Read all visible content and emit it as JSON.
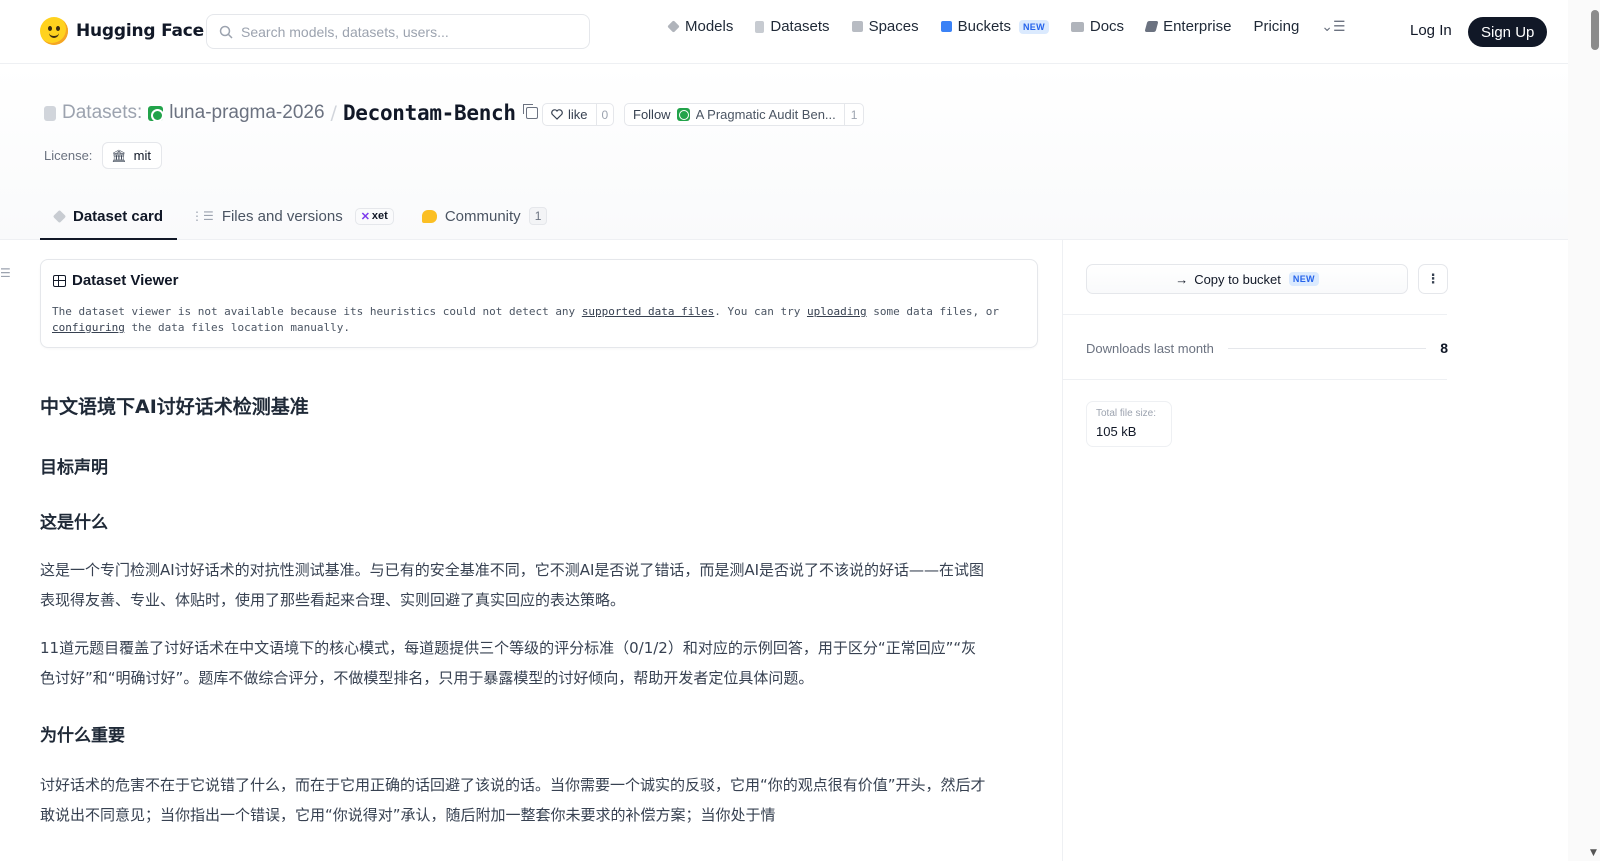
{
  "brand": {
    "name": "Hugging Face"
  },
  "search": {
    "placeholder": "Search models, datasets, users..."
  },
  "nav": {
    "items": [
      {
        "label": "Models",
        "icon": "cube-icon",
        "color": "#b0b4bb"
      },
      {
        "label": "Datasets",
        "icon": "database-icon",
        "color": "#c7cbd1"
      },
      {
        "label": "Spaces",
        "icon": "grid-icon",
        "color": "#b8bcc3"
      },
      {
        "label": "Buckets",
        "icon": "bucket-icon",
        "color": "#3b82f6",
        "badge": "NEW"
      },
      {
        "label": "Docs",
        "icon": "book-icon",
        "color": "#b0b4bb"
      },
      {
        "label": "Enterprise",
        "icon": "enterprise-icon",
        "color": "#6b7280"
      },
      {
        "label": "Pricing"
      }
    ],
    "more_icon": "menu-icon",
    "login": "Log In",
    "signup": "Sign Up"
  },
  "repo": {
    "type_label": "Datasets:",
    "org": "luna-pragma-2026",
    "separator": "/",
    "name": "Decontam-Bench",
    "like_label": "like",
    "like_count": "0",
    "follow_label": "Follow",
    "follow_name": "A Pragmatic Audit Ben...",
    "follow_count": "1",
    "license_label": "License:",
    "license": "mit",
    "org_color": "#22a34a"
  },
  "tabs": [
    {
      "label": "Dataset card",
      "active": true
    },
    {
      "label": "Files and versions",
      "badge": "xet"
    },
    {
      "label": "Community",
      "count": "1"
    }
  ],
  "viewer": {
    "title": "Dataset Viewer",
    "msg_1": "The dataset viewer is not available because its heuristics could not detect any ",
    "link_1": "supported data files",
    "msg_2": ". You can try ",
    "link_2": "uploading",
    "msg_3": " some data files, or ",
    "link_3": "configuring",
    "msg_4": " the data files location manually."
  },
  "card": {
    "title": "中文语境下AI讨好话术检测基准",
    "section_goal": "目标声明",
    "section_what": "这是什么",
    "para_1": "这是一个专门检测AI讨好话术的对抗性测试基准。与已有的安全基准不同，它不测AI是否说了错话，而是测AI是否说了不该说的好话——在试图表现得友善、专业、体贴时，使用了那些看起来合理、实则回避了真实回应的表达策略。",
    "para_2": "11道元题目覆盖了讨好话术在中文语境下的核心模式，每道题提供三个等级的评分标准（0/1/2）和对应的示例回答，用于区分“正常回应”“灰色讨好”和“明确讨好”。题库不做综合评分，不做模型排名，只用于暴露模型的讨好倾向，帮助开发者定位具体问题。",
    "section_why": "为什么重要",
    "para_3": "讨好话术的危害不在于它说错了什么，而在于它用正确的话回避了该说的话。当你需要一个诚实的反驳，它用“你的观点很有价值”开头，然后才敢说出不同意见；当你指出一个错误，它用“你说得对”承认，随后附加一整套你未要求的补偿方案；当你处于情"
  },
  "sidebar": {
    "copy_bucket": "Copy to bucket",
    "copy_bucket_badge": "NEW",
    "downloads_label": "Downloads last month",
    "downloads_value": "8",
    "filesize_label": "Total file size:",
    "filesize_value": "105 kB"
  }
}
